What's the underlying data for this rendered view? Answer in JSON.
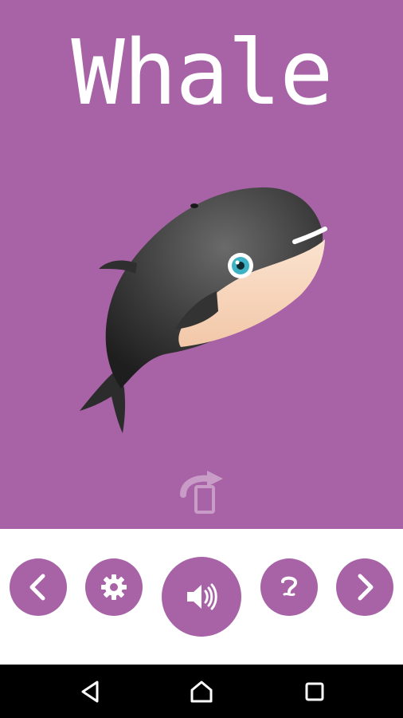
{
  "animal": {
    "name": "Whale"
  },
  "colors": {
    "accent": "#a763a6",
    "background": "#ffffff",
    "navbar": "#000000"
  },
  "controls": {
    "prev": {
      "icon": "chevron-left-icon"
    },
    "settings": {
      "icon": "gear-icon"
    },
    "sound": {
      "icon": "speaker-icon"
    },
    "help": {
      "icon": "question-icon"
    },
    "next": {
      "icon": "chevron-right-icon"
    }
  },
  "navbar": {
    "buttons": [
      "back-triangle-icon",
      "home-icon",
      "recents-square-icon"
    ]
  }
}
